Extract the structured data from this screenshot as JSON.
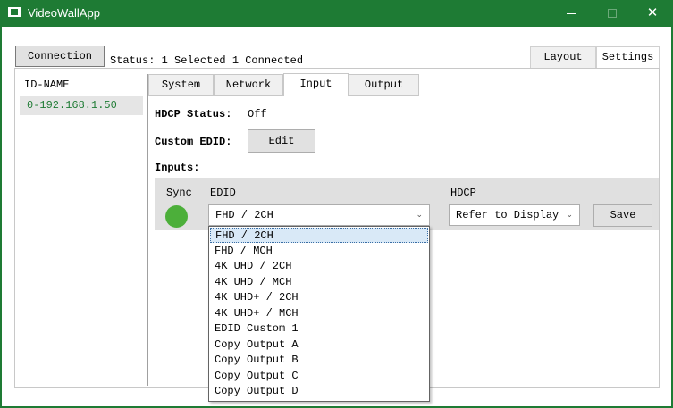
{
  "window": {
    "title": "VideoWallApp",
    "minimize_glyph": "—",
    "maximize_glyph": "☐",
    "close_glyph": "✕",
    "accent_color": "#1e7b34"
  },
  "toolbar": {
    "connection_label": "Connection",
    "status_text": "Status: 1 Selected 1 Connected"
  },
  "top_tabs": [
    {
      "label": "Layout",
      "active": false
    },
    {
      "label": "Settings",
      "active": true
    }
  ],
  "sidebar": {
    "header": "ID-NAME",
    "devices": [
      "0-192.168.1.50"
    ]
  },
  "sub_tabs": [
    {
      "label": "System",
      "active": false
    },
    {
      "label": "Network",
      "active": false
    },
    {
      "label": "Input",
      "active": true
    },
    {
      "label": "Output",
      "active": false
    }
  ],
  "input": {
    "hdcp_status_label": "HDCP Status:",
    "hdcp_status_value": "Off",
    "custom_edid_label": "Custom EDID:",
    "edit_label": "Edit",
    "inputs_label": "Inputs:",
    "sync_header": "Sync",
    "edid_header": "EDID",
    "hdcp_header": "HDCP",
    "sync_color": "#4caf3a",
    "edid_selected": "FHD / 2CH",
    "hdcp_selected": "Refer to Display",
    "save_label": "Save",
    "chevron_glyph": "⌄"
  },
  "edid_options": [
    "FHD / 2CH",
    "FHD / MCH",
    "4K UHD / 2CH",
    "4K UHD / MCH",
    "4K UHD+ / 2CH",
    "4K UHD+ / MCH",
    "EDID Custom 1",
    "Copy Output A",
    "Copy Output B",
    "Copy Output C",
    "Copy Output D"
  ]
}
